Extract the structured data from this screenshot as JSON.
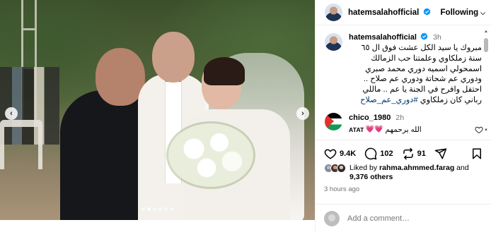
{
  "post": {
    "username": "hatemsalahofficial",
    "follow_status": "Following",
    "caption_time": "3h",
    "caption": "مبروك يا سيد الكل عشت فوق ال ٦٥ سنة زملكاوي وعلمتنا حب الزمالك اسمحولي اسميه دوري محمد صبري ودوري عم شحاتة ودوري عم صلاح .. احتفل وافرح في الجنة يا عم .. ماللي رباني كان زملكاوي",
    "hashtag": "#دوري_عم_صلاح",
    "carousel": {
      "total": 6,
      "active": 1
    }
  },
  "comment": {
    "username": "chico_1980",
    "time": "2h",
    "prefix": "ATAT",
    "hearts": "💗💗",
    "text": "الله يرحمهم"
  },
  "actions": {
    "likes": "9.4K",
    "comments": "102",
    "reposts": "91"
  },
  "likes_summary": {
    "prefix": "Liked by ",
    "user": "rahma.ahmmed.farag",
    "middle": " and",
    "others": "9,376 others"
  },
  "post_time": "3 hours ago",
  "add_comment": {
    "placeholder": "Add a comment…"
  },
  "icons": {
    "verified": "verified-badge-icon",
    "like": "heart-icon",
    "comment": "comment-bubble-icon",
    "repost": "repost-icon",
    "share": "send-icon",
    "save": "bookmark-icon"
  },
  "colors": {
    "verified": "#0095f6",
    "hashtag": "#00376b",
    "heart": "#ed2850"
  }
}
